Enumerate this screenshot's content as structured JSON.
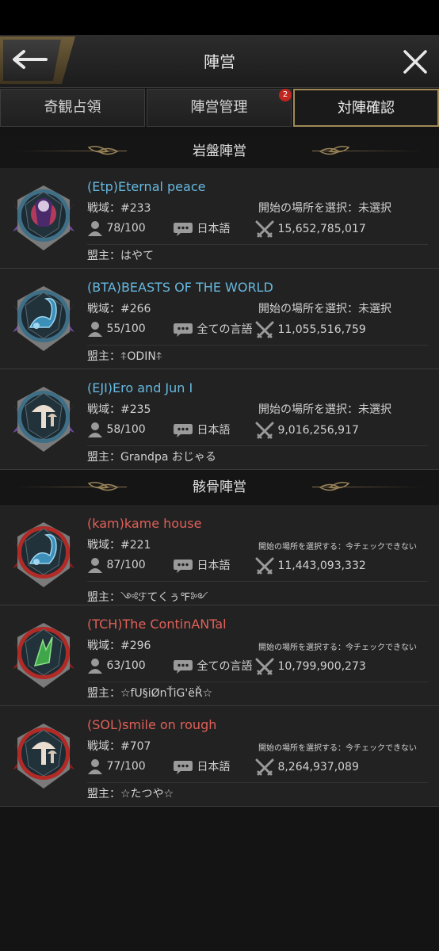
{
  "header": {
    "title": "陣営"
  },
  "tabs": [
    {
      "label": "奇観占領"
    },
    {
      "label": "陣営管理",
      "badge": "2"
    },
    {
      "label": "対陣確認"
    }
  ],
  "colors": {
    "ally_name": "#66b9e0",
    "enemy_name": "#e06058",
    "accent_gold": "#a08a57"
  },
  "sections": [
    {
      "title": "岩盤陣営",
      "guilds": [
        {
          "name": "(Etp)Eternal peace",
          "server": "戦域：#233",
          "start": "開始の場所を選択：未選択",
          "members": "78/100",
          "language": "日本語",
          "power": "15,652,785,017",
          "leader": "盟主：はやて",
          "emblem": "purple-woman"
        },
        {
          "name": "(BTA)BEASTS OF THE WORLD",
          "server": "戦域：#266",
          "start": "開始の場所を選択：未選択",
          "members": "55/100",
          "language": "全ての言語",
          "power": "11,055,516,759",
          "leader": "盟主：⍏ODIN⍏",
          "emblem": "blue-scorpion"
        },
        {
          "name": "(EJI)Ero and Jun I",
          "server": "戦域：#235",
          "start": "開始の場所を選択：未選択",
          "members": "58/100",
          "language": "日本語",
          "power": "9,016,256,917",
          "leader": "盟主：Grandpa おじゃる",
          "emblem": "mushroom"
        }
      ]
    },
    {
      "title": "骸骨陣営",
      "guilds": [
        {
          "name": "(kam)kame house",
          "server": "戦域：#221",
          "start": "開始の場所を選択する：今チェックできない",
          "members": "87/100",
          "language": "日本語",
          "power": "11,443,093,332",
          "leader": "盟主：༺ℱてくぅ℉༻",
          "emblem": "blue-scorpion"
        },
        {
          "name": "(TCH)The ContinANTal",
          "server": "戦域：#296",
          "start": "開始の場所を選択する：今チェックできない",
          "members": "63/100",
          "language": "全ての言語",
          "power": "10,799,900,273",
          "leader": "盟主：☆fU§iØnŤiG'ëŘ☆",
          "emblem": "mantis"
        },
        {
          "name": "(SOL)smile on rough",
          "server": "戦域：#707",
          "start": "開始の場所を選択する：今チェックできない",
          "members": "77/100",
          "language": "日本語",
          "power": "8,264,937,089",
          "leader": "盟主：☆たつや☆",
          "emblem": "mushroom"
        }
      ]
    }
  ]
}
